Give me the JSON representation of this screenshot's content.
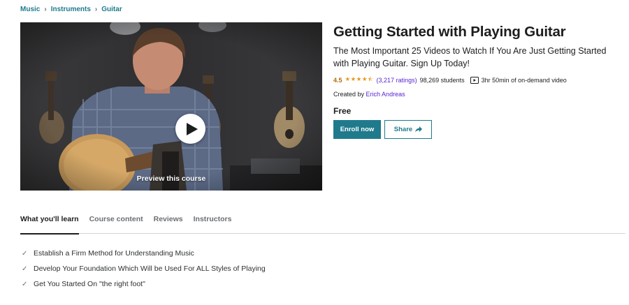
{
  "breadcrumb": [
    {
      "label": "Music"
    },
    {
      "label": "Instruments"
    },
    {
      "label": "Guitar"
    }
  ],
  "preview": {
    "label": "Preview this course",
    "icon": "play-icon"
  },
  "course": {
    "title": "Getting Started with Playing Guitar",
    "subtitle": "The Most Important 25 Videos to Watch If You Are Just Getting Started with Playing Guitar. Sign Up Today!",
    "rating": "4.5",
    "stars_value": 4.5,
    "stars_glyphs": "★★★★⯪",
    "ratings_count": "(3,217 ratings)",
    "students": "98,269 students",
    "video_length": "3hr 50min of on-demand video",
    "created_by_label": "Created by",
    "author": "Erich Andreas",
    "price": "Free"
  },
  "actions": {
    "enroll_label": "Enroll now",
    "share_label": "Share"
  },
  "tabs": [
    {
      "label": "What you'll learn",
      "active": true
    },
    {
      "label": "Course content",
      "active": false
    },
    {
      "label": "Reviews",
      "active": false
    },
    {
      "label": "Instructors",
      "active": false
    }
  ],
  "learn_items": [
    "Establish a Firm Method for Understanding Music",
    "Develop Your Foundation Which Will be Used For ALL Styles of Playing",
    "Get You Started On \"the right foot\""
  ],
  "colors": {
    "accent": "#1f7a8c",
    "link_purple": "#5624d0",
    "rating_orange": "#b4690e",
    "star": "#e59819"
  }
}
